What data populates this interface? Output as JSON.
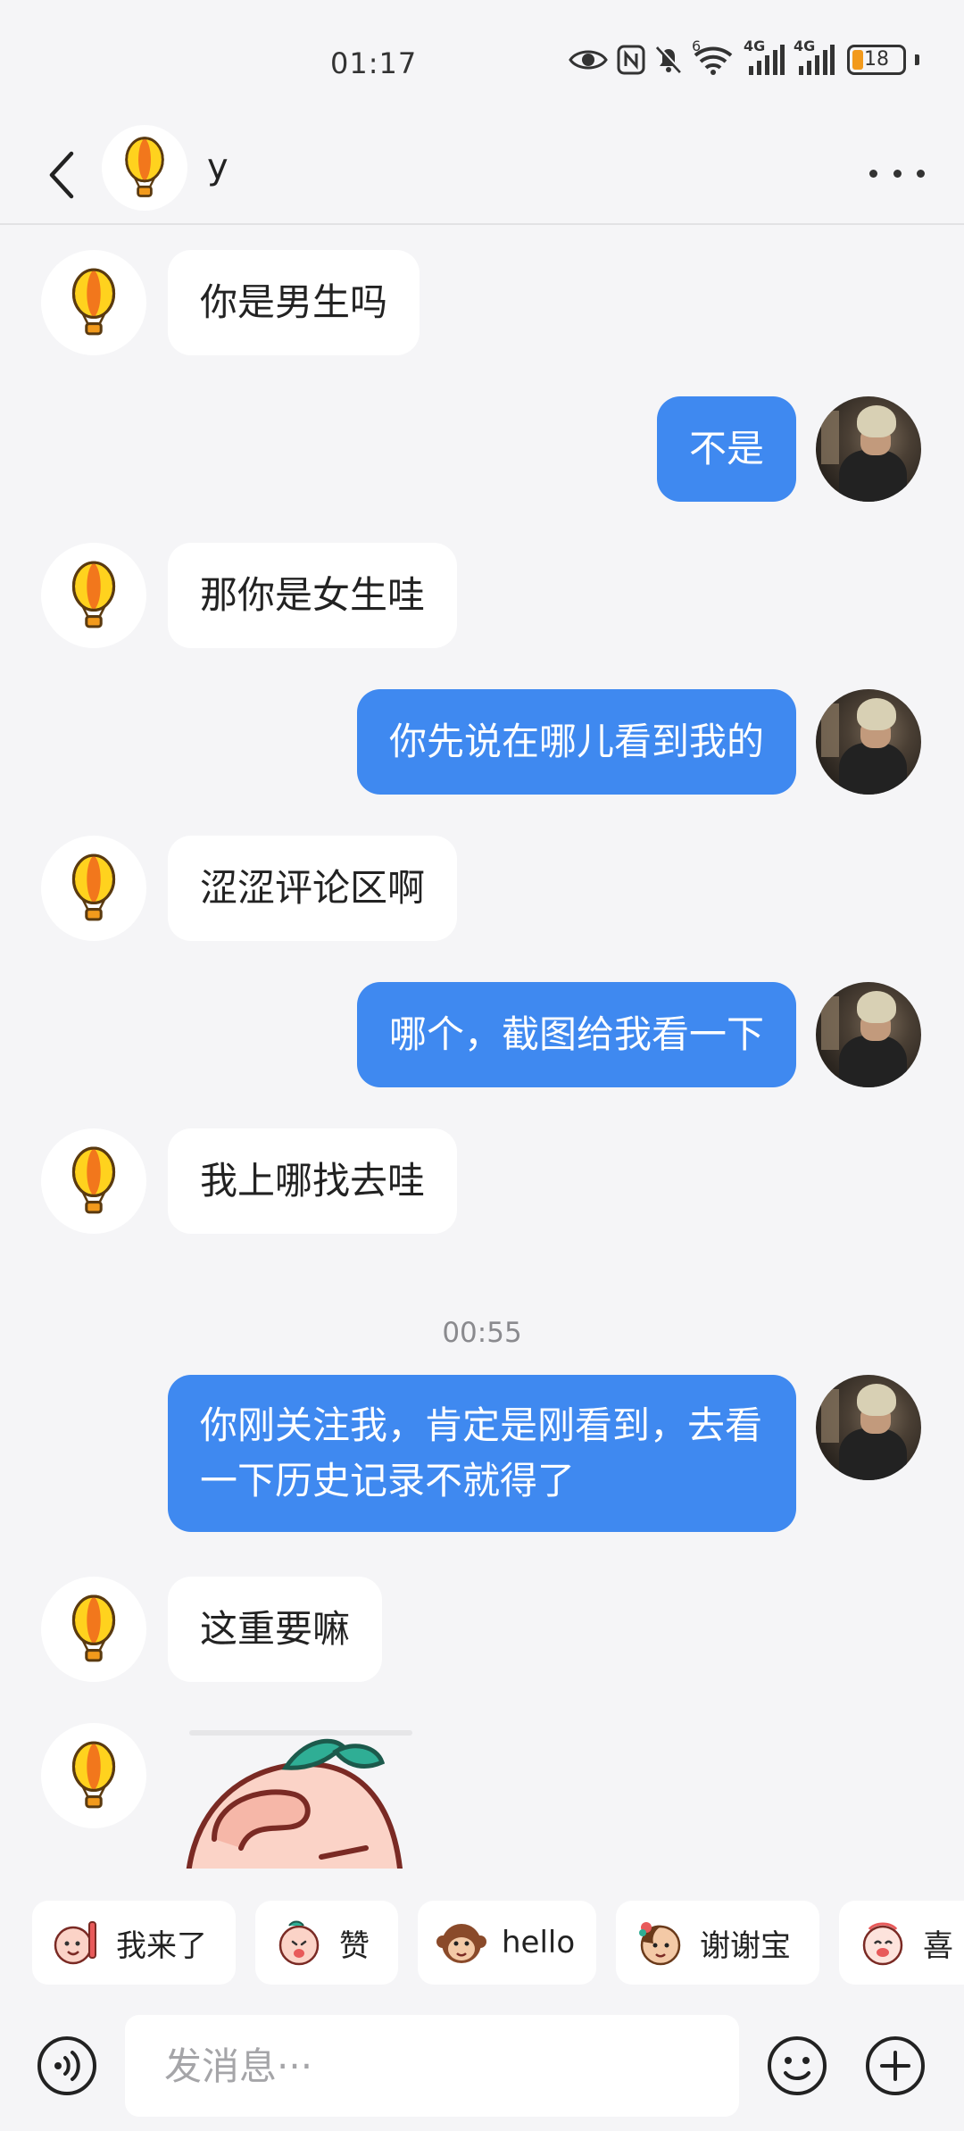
{
  "status_bar": {
    "time": "01:17",
    "network_1": "4G",
    "network_2": "4G",
    "wifi_badge": "6",
    "battery": "18"
  },
  "header": {
    "contact_name": "y"
  },
  "messages": [
    {
      "side": "in",
      "text": "你是男生吗"
    },
    {
      "side": "out",
      "text": "不是"
    },
    {
      "side": "in",
      "text": "那你是女生哇"
    },
    {
      "side": "out",
      "text": "你先说在哪儿看到我的"
    },
    {
      "side": "in",
      "text": "涩涩评论区啊"
    },
    {
      "side": "out",
      "text": "哪个，截图给我看一下"
    },
    {
      "side": "in",
      "text": "我上哪找去哇"
    },
    {
      "side": "out",
      "text": "你刚关注我，肯定是刚看到，去看一下历史记录不就得了"
    },
    {
      "side": "in",
      "text": "这重要嘛"
    }
  ],
  "timestamp": "00:55",
  "quick_replies": [
    {
      "label": "我来了",
      "icon": "sticker-wave-icon"
    },
    {
      "label": "赞",
      "icon": "sticker-thumbs-icon"
    },
    {
      "label": "hello",
      "icon": "sticker-monkey-icon"
    },
    {
      "label": "谢谢宝",
      "icon": "sticker-flower-icon"
    },
    {
      "label": "喜",
      "icon": "sticker-happy-icon"
    }
  ],
  "input": {
    "placeholder": "发消息···"
  },
  "colors": {
    "outgoing_bubble": "#3f89f0",
    "incoming_bubble": "#ffffff",
    "background": "#f5f5f7",
    "balloon_orange": "#f29a1c",
    "balloon_yellow": "#ffd21e"
  }
}
